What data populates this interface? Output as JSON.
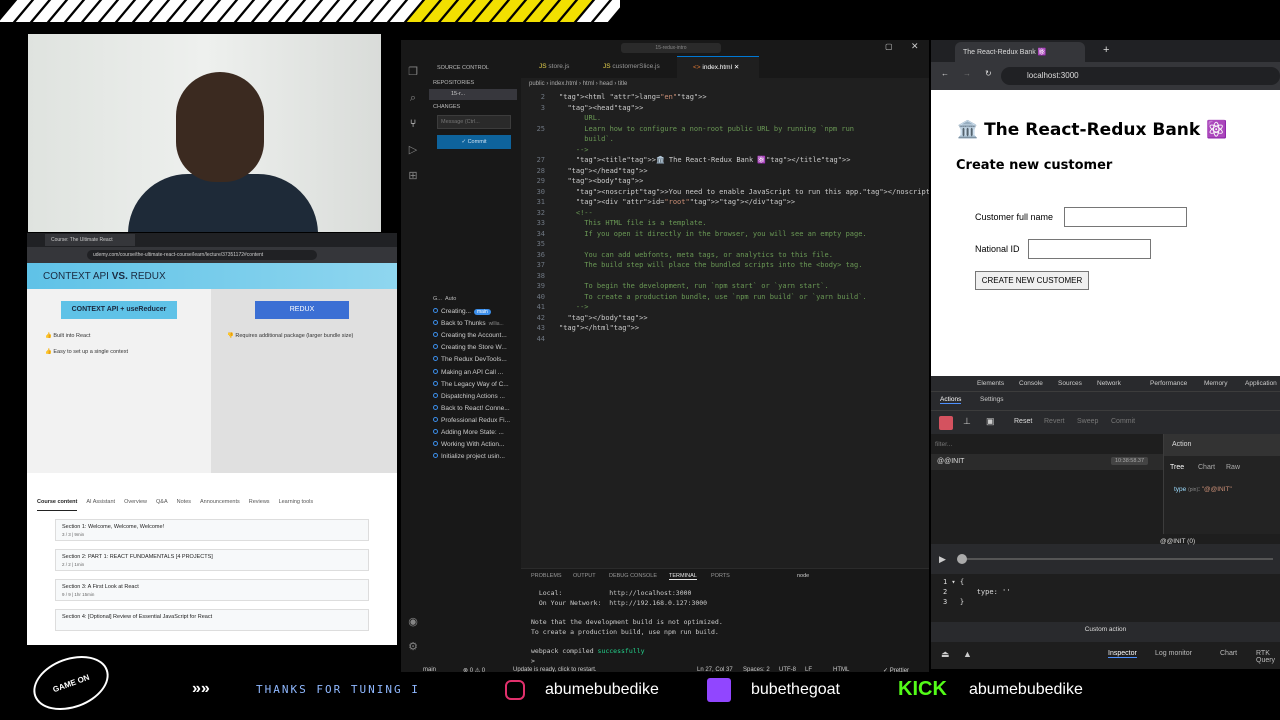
{
  "webcam": {
    "label": "Webcam feed"
  },
  "udemy": {
    "tab_title": "Course: The Ultimate React",
    "url": "udemy.com/course/the-ultimate-react-course/learn/lecture/37351172#content",
    "slide_title_a": "CONTEXT API ",
    "slide_title_vs": "VS.",
    "slide_title_b": " REDUX",
    "left_button": "CONTEXT API + useReducer",
    "right_button": "REDUX",
    "left_note_1": "👍 Built into React",
    "left_note_2": "👍 Easy to set up a single context",
    "right_note_1": "👎 Requires additional package (larger bundle size)",
    "course_tabs": [
      "Course content",
      "AI Assistant",
      "Overview",
      "Q&A",
      "Notes",
      "Announcements",
      "Reviews",
      "Learning tools"
    ],
    "sections": [
      {
        "title": "Section 1: Welcome, Welcome, Welcome!",
        "sub": "3 / 3 | 9min"
      },
      {
        "title": "Section 2: PART 1: REACT FUNDAMENTALS [4 PROJECTS]",
        "sub": "2 / 2 | 1min"
      },
      {
        "title": "Section 3: A First Look at React",
        "sub": "9 / 9 | 1hr 15min"
      },
      {
        "title": "Section 4: [Optional] Review of Essential JavaScript for React",
        "sub": ""
      }
    ]
  },
  "vscode": {
    "title": "15-redux-intro",
    "tabs": [
      "store.js",
      "customerSlice.js",
      "index.html"
    ],
    "breadcrumb": "public › index.html › html › head › title",
    "sidebar": {
      "header": "SOURCE CONTROL",
      "repositories": "REPOSITORIES",
      "repo": "15-r...",
      "changes": "CHANGES",
      "message_placeholder": "Message (Ctrl...",
      "commit_label": "✓ Commit",
      "graph_label": "G...",
      "auto_label": "Auto",
      "commits": [
        "Creating...",
        "Back to Thunks",
        "Creating the Account...",
        "Creating the Store W...",
        "The Redux DevTools...",
        "Making an API Call ...",
        "The Legacy Way of C...",
        "Dispatching Actions ...",
        "Back to React! Conne...",
        "Professional Redux Fi...",
        "Adding More State: ...",
        "Working With Action...",
        "Initialize project usin..."
      ],
      "commit_tag": "main",
      "commit_author": "willia..."
    },
    "line_numbers": [
      "2",
      "3",
      "",
      "25",
      "",
      "",
      "27",
      "28",
      "29",
      "30",
      "31",
      "32",
      "33",
      "34",
      "35",
      "36",
      "37",
      "38",
      "39",
      "40",
      "41",
      "42",
      "43",
      "44"
    ],
    "code_lines": [
      "<html lang=\"en\">",
      "  <head>",
      "      URL.",
      "      Learn how to configure a non-root public URL by running `npm run",
      "      build`.",
      "    -->",
      "    <title>🏛️ The React-Redux Bank ⚛️</title>",
      "  </head>",
      "  <body>",
      "    <noscript>You need to enable JavaScript to run this app.</noscript>",
      "    <div id=\"root\"></div>",
      "    <!--",
      "      This HTML file is a template.",
      "      If you open it directly in the browser, you will see an empty page.",
      "",
      "      You can add webfonts, meta tags, or analytics to this file.",
      "      The build step will place the bundled scripts into the <body> tag.",
      "",
      "      To begin the development, run `npm start` or `yarn start`.",
      "      To create a production bundle, use `npm run build` or `yarn build`.",
      "    -->",
      "  </body>",
      "</html>",
      ""
    ],
    "panel_tabs": [
      "PROBLEMS",
      "OUTPUT",
      "DEBUG CONSOLE",
      "TERMINAL",
      "PORTS"
    ],
    "terminal_shell": "node",
    "terminal_lines": [
      "  Local:            http://localhost:3000",
      "  On Your Network:  http://192.168.0.127:3000",
      "",
      "Note that the development build is not optimized.",
      "To create a production build, use npm run build.",
      "",
      "webpack compiled successfully",
      ">"
    ],
    "status": {
      "branch": "main",
      "errors": "⊗ 0 ⚠ 0",
      "ports": "0",
      "message": "Update is ready, click to restart.",
      "position": "Ln 27, Col 37",
      "spaces": "Spaces: 2",
      "encoding": "UTF-8",
      "eol": "LF",
      "language": "HTML",
      "prettier": "✓ Prettier"
    }
  },
  "bank": {
    "tab_title": "The React-Redux Bank ⚛️",
    "url": "localhost:3000",
    "heading": "🏛️ The React-Redux Bank ⚛️",
    "subheading": "Create new customer",
    "label_name": "Customer full name",
    "label_id": "National ID",
    "button": "CREATE NEW CUSTOMER"
  },
  "devtools": {
    "tabs": [
      "Elements",
      "Console",
      "Sources",
      "Network",
      "Performance",
      "Memory",
      "Application"
    ],
    "sub_tabs": [
      "Actions",
      "Settings"
    ],
    "toolbar": [
      "Reset",
      "Revert",
      "Sweep",
      "Commit"
    ],
    "filter_placeholder": "filter...",
    "action_name": "@@INIT",
    "action_time": "10:38:58.37",
    "right_title": "Action",
    "right_tabs": [
      "Tree",
      "Chart",
      "Raw"
    ],
    "tree_key": "type",
    "tree_meta": "(pin)",
    "tree_value": "\"@@INIT\"",
    "slider_label": "@@INIT (0)",
    "json_lines": [
      "1 ▾ {",
      "2       type: ''",
      "3   }"
    ],
    "custom_action": "Custom action",
    "bottom_tabs": [
      "Inspector",
      "Log monitor",
      "Chart",
      "RTK Query"
    ]
  },
  "bottom": {
    "ticker": "THANKS FOR TUNING I",
    "instagram": "abumebubedike",
    "twitch": "bubethegoat",
    "kick_logo": "KICK",
    "kick": "abumebubedike",
    "badge": "GAME ON"
  },
  "colors": {
    "accent": "#f2e000",
    "vscode_blue": "#0078d4",
    "twitch": "#9146ff",
    "kick": "#53fc18",
    "instagram": "#e1306c"
  }
}
